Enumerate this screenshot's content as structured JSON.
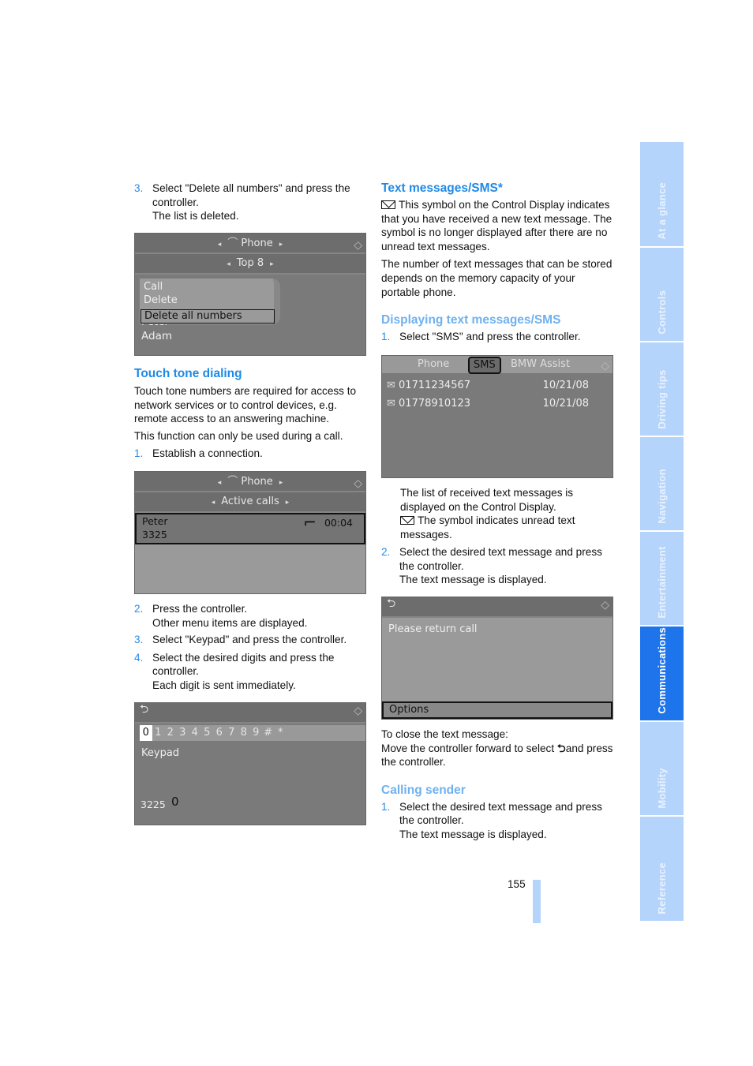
{
  "left": {
    "step3": {
      "num": "3.",
      "text": "Select \"Delete all numbers\" and press the controller.",
      "sub": "The list is deleted."
    },
    "screen1": {
      "title": "Phone",
      "subtitle": "Top 8",
      "menu": [
        "Call",
        "Delete",
        "Delete all numbers"
      ],
      "list": [
        "Peter",
        "Adam"
      ]
    },
    "touch_heading": "Touch tone dialing",
    "touch_p1": "Touch tone numbers are required for access to network services or to control devices, e.g. remote access to an answering machine.",
    "touch_p2": "This function can only be used during a call.",
    "step1": {
      "num": "1.",
      "text": "Establish a connection."
    },
    "screen2": {
      "title": "Phone",
      "subtitle": "Active calls",
      "name": "Peter",
      "number": "3325",
      "time": "00:04"
    },
    "step2": {
      "num": "2.",
      "text": "Press the controller.",
      "sub": "Other menu items are displayed."
    },
    "step3b": {
      "num": "3.",
      "text": "Select \"Keypad\" and press the controller."
    },
    "step4": {
      "num": "4.",
      "text": "Select the desired digits and press the controller.",
      "sub": "Each digit is sent immediately."
    },
    "screen3": {
      "keys": [
        "0",
        "1",
        "2",
        "3",
        "4",
        "5",
        "6",
        "7",
        "8",
        "9",
        "#",
        "*"
      ],
      "label": "Keypad",
      "entry": "3225",
      "current": "0"
    }
  },
  "right": {
    "sms_heading": "Text messages/SMS*",
    "sms_p1": "This symbol on the Control Display indicates that you have received a new text message. The symbol is no longer displayed after there are no unread text messages.",
    "sms_p2": "The number of text messages that can be stored depends on the memory capacity of your portable phone.",
    "disp_heading": "Displaying text messages/SMS",
    "step1": {
      "num": "1.",
      "text": "Select \"SMS\" and press the controller."
    },
    "screen4": {
      "tabs": [
        "Phone",
        "SMS",
        "BMW Assist"
      ],
      "messages": [
        {
          "number": "01711234567",
          "date": "10/21/08"
        },
        {
          "number": "01778910123",
          "date": "10/21/08"
        }
      ]
    },
    "list_p1": "The list of received text messages is displayed on the Control Display.",
    "list_p2": "The symbol indicates unread text messages.",
    "step2": {
      "num": "2.",
      "text": "Select the desired text message and press the controller.",
      "sub": "The text message is displayed."
    },
    "screen5": {
      "message": "Please return call",
      "options": "Options"
    },
    "close_p1": "To close the text message:",
    "close_p2a": "Move the controller forward to select",
    "close_p2b": "and press the controller.",
    "call_heading": "Calling sender",
    "step1b": {
      "num": "1.",
      "text": "Select the desired text message and press the controller.",
      "sub": "The text message is displayed."
    }
  },
  "page_number": "155",
  "sidebar": {
    "tabs": [
      "At a glance",
      "Controls",
      "Driving tips",
      "Navigation",
      "Entertainment",
      "Communications",
      "Mobility",
      "Reference"
    ],
    "active": "Communications"
  },
  "colors": {
    "heading": "#1f8ae6",
    "subheading": "#6fb1f0",
    "tab": "#b5d4fb",
    "tab_active": "#1e74ea"
  }
}
